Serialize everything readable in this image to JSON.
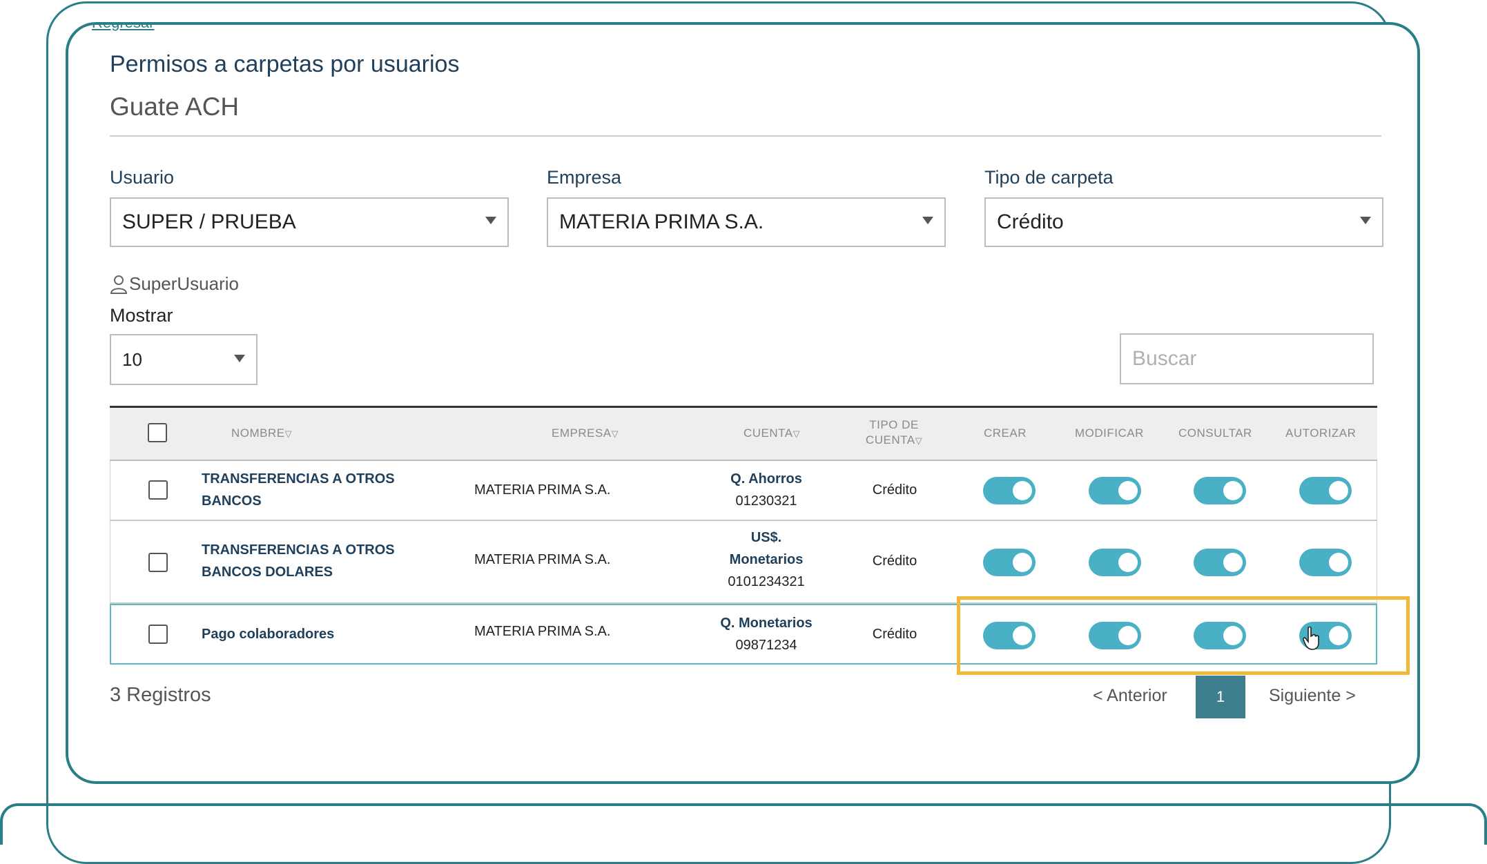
{
  "header": {
    "back_link": "Regresar",
    "title": "Permisos a carpetas por usuarios",
    "subtitle": "Guate ACH"
  },
  "filters": {
    "usuario_label": "Usuario",
    "usuario_value": "SUPER / PRUEBA",
    "empresa_label": "Empresa",
    "empresa_value": "MATERIA PRIMA S.A.",
    "tipo_label": "Tipo de carpeta",
    "tipo_value": "Crédito"
  },
  "superuser": "SuperUsuario",
  "mostrar": {
    "label": "Mostrar",
    "value": "10"
  },
  "search": {
    "placeholder": "Buscar"
  },
  "table": {
    "headers": {
      "nombre": "NOMBRE",
      "empresa": "EMPRESA",
      "cuenta": "CUENTA",
      "tipo_1": "TIPO DE",
      "tipo_2": "CUENTA",
      "crear": "CREAR",
      "modificar": "MODIFICAR",
      "consultar": "CONSULTAR",
      "autorizar": "AUTORIZAR"
    },
    "rows": [
      {
        "name_1": "TRANSFERENCIAS A OTROS",
        "name_2": "BANCOS",
        "empresa": "MATERIA PRIMA S.A.",
        "cuenta_1": "Q. Ahorros",
        "cuenta_2": "01230321",
        "tipo": "Crédito"
      },
      {
        "name_1": "TRANSFERENCIAS A OTROS",
        "name_2": "BANCOS DOLARES",
        "empresa": "MATERIA PRIMA S.A.",
        "cuenta_1": "US$.",
        "cuenta_2": "Monetarios",
        "cuenta_3": "0101234321",
        "tipo": "Crédito"
      },
      {
        "name": "Pago colaboradores",
        "empresa": "MATERIA PRIMA S.A.",
        "cuenta_1": "Q. Monetarios",
        "cuenta_2": "09871234",
        "tipo": "Crédito"
      }
    ]
  },
  "footer": {
    "records": "3 Registros",
    "prev": "< Anterior",
    "page": "1",
    "next": "Siguiente >"
  },
  "colors": {
    "toggle_on": "#49b0c6",
    "frame": "#2a7e87",
    "highlight": "#f0b93a",
    "pager_active": "#3e7f8f"
  }
}
